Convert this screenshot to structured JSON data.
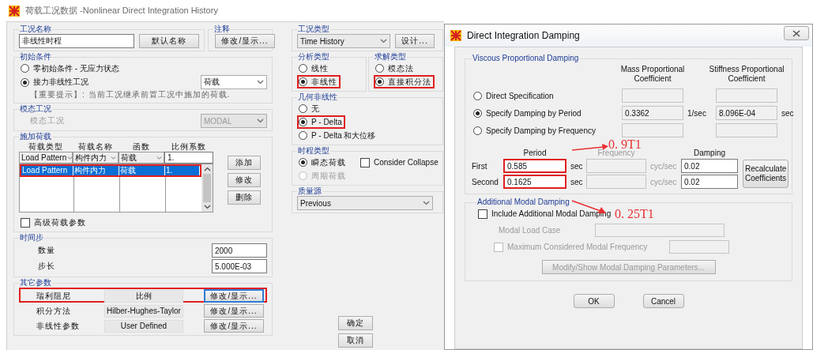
{
  "main_window": {
    "title": "荷载工况数据 -Nonlinear Direct Integration History",
    "case_name": {
      "legend": "工况名称",
      "value": "非线性时程",
      "button": "默认名称"
    },
    "notes": {
      "legend": "注释",
      "button": "修改/显示..."
    },
    "initial_conditions": {
      "legend": "初始条件",
      "options": [
        {
          "label": "零初始条件 - 无应力状态",
          "selected": false
        },
        {
          "label": "接力非线性工况",
          "selected": true
        }
      ],
      "dropdown": "荷载",
      "hint": "【重要提示】:   当前工况继承前置工况中施加的荷载."
    },
    "modal_case": {
      "legend": "模态工况",
      "label": "模态工况",
      "dropdown": "MODAL",
      "disabled": true
    },
    "loads_applied": {
      "legend": "施加荷载",
      "columns": [
        "荷载类型",
        "荷载名称",
        "函数",
        "比例系数"
      ],
      "entry": [
        "Load Pattern",
        "构件内力",
        "荷载",
        "1."
      ],
      "rows": [
        {
          "cells": [
            "Load Pattern",
            "构件内力",
            "荷载",
            "1."
          ],
          "selected": true,
          "highlighted": true
        }
      ],
      "buttons": [
        "添加",
        "修改",
        "删除"
      ],
      "advanced": {
        "label": "高级荷载参数",
        "checked": false
      }
    },
    "time_step": {
      "legend": "时间步",
      "fields": [
        {
          "label": "数量",
          "value": "2000"
        },
        {
          "label": "步长",
          "value": "5.000E-03"
        }
      ]
    },
    "other_parameters": {
      "legend": "其它参数",
      "rows": [
        {
          "label": "瑞利阻尼",
          "value": "比例",
          "button": "修改/显示...",
          "highlighted": true,
          "focused": true
        },
        {
          "label": "积分方法",
          "value": "Hilber-Hughes-Taylor",
          "button": "修改/显示...",
          "highlighted": false,
          "focused": false
        },
        {
          "label": "非线性参数",
          "value": "User Defined",
          "button": "修改/显示...",
          "highlighted": false,
          "focused": false
        }
      ]
    },
    "case_type": {
      "legend": "工况类型",
      "dropdown": "Time History",
      "button": "设计..."
    },
    "analysis_type": {
      "legend": "分析类型",
      "options": [
        {
          "label": "线性",
          "selected": false,
          "highlighted": false
        },
        {
          "label": "非线性",
          "selected": true,
          "highlighted": true
        }
      ]
    },
    "solution_type": {
      "legend": "求解类型",
      "options": [
        {
          "label": "模态法",
          "selected": false,
          "highlighted": false
        },
        {
          "label": "直接积分法",
          "selected": true,
          "highlighted": true
        }
      ]
    },
    "geometric_nonlinearity": {
      "legend": "几何非线性",
      "options": [
        {
          "label": "无",
          "selected": false,
          "highlighted": false
        },
        {
          "label": "P - Delta",
          "selected": true,
          "highlighted": true
        },
        {
          "label": "P - Delta 和大位移",
          "selected": false,
          "highlighted": false
        }
      ]
    },
    "history_type": {
      "legend": "时程类型",
      "options": [
        {
          "label": "瞬态荷载",
          "selected": true,
          "disabled": false
        },
        {
          "label": "周期荷载",
          "selected": false,
          "disabled": true
        }
      ],
      "collapse": {
        "label": "Consider Collapse",
        "checked": false
      }
    },
    "mass_source": {
      "legend": "质量源",
      "dropdown": "Previous"
    },
    "buttons": [
      "确定",
      "取消"
    ]
  },
  "damping_dialog": {
    "title": "Direct Integration Damping",
    "viscous": {
      "legend": "Viscous Proportional Damping",
      "headers": [
        "Mass Proportional Coefficient",
        "Stiffness Proportional Coefficient"
      ],
      "options": [
        {
          "label": "Direct Specification",
          "selected": false
        },
        {
          "label": "Specify Damping by Period",
          "selected": true,
          "mass": "0.3362",
          "mass_unit": "1/sec",
          "stiffness": "8.096E-04",
          "stiffness_unit": "sec"
        },
        {
          "label": "Specify Damping by Frequency",
          "selected": false
        }
      ],
      "table_headers": [
        "Period",
        "Frequency",
        "Damping"
      ],
      "rows": [
        {
          "label": "First",
          "period": "0.585",
          "period_unit": "sec",
          "frequency_unit": "cyc/sec",
          "damping": "0.02",
          "highlighted": true
        },
        {
          "label": "Second",
          "period": "0.1625",
          "period_unit": "sec",
          "frequency_unit": "cyc/sec",
          "damping": "0.02",
          "highlighted": true
        }
      ],
      "button": "Recalculate Coefficients"
    },
    "modal": {
      "legend": "Additional Modal Damping",
      "include": {
        "label": "Include Additional Modal Damping",
        "checked": false
      },
      "load_case_label": "Modal Load Case",
      "max_frequency": {
        "label": "Maximum Considered Modal Frequency",
        "checked": false
      },
      "button": "Modify/Show Modal Damping Parameters...",
      "disabled": true
    },
    "buttons": [
      "OK",
      "Cancel"
    ]
  },
  "annotations": [
    {
      "text": "0. 9T1"
    },
    {
      "text": "0. 25T1"
    }
  ]
}
